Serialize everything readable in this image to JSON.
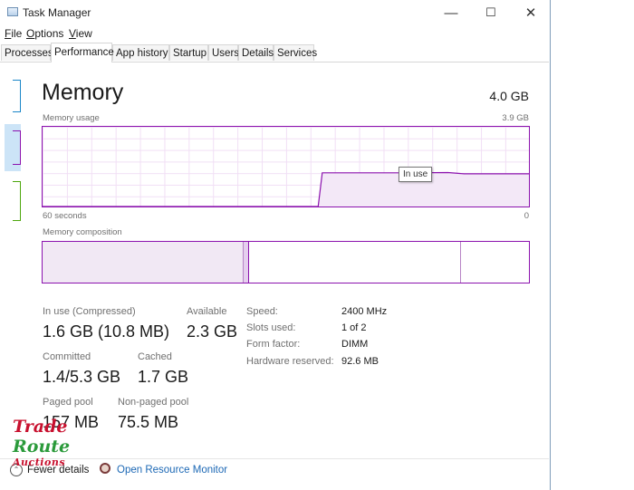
{
  "window": {
    "title": "Task Manager",
    "controls": {
      "minimize": "—",
      "maximize": "☐",
      "close": "✕"
    }
  },
  "menu": [
    "File",
    "Options",
    "View"
  ],
  "tabs": [
    {
      "label": "Processes",
      "active": false
    },
    {
      "label": "Performance",
      "active": true
    },
    {
      "label": "App history",
      "active": false
    },
    {
      "label": "Startup",
      "active": false
    },
    {
      "label": "Users",
      "active": false
    },
    {
      "label": "Details",
      "active": false
    },
    {
      "label": "Services",
      "active": false
    }
  ],
  "memory": {
    "heading": "Memory",
    "total": "4.0 GB",
    "usage_label": "Memory usage",
    "usage_max": "3.9 GB",
    "time_left": "60 seconds",
    "time_right": "0",
    "tooltip": "In use",
    "composition_label": "Memory composition"
  },
  "chart_data": {
    "type": "area",
    "title": "Memory usage",
    "xlabel": "",
    "ylabel": "",
    "xlim": [
      60,
      0
    ],
    "ylim": [
      0,
      3.9
    ],
    "x": [
      60,
      59,
      57,
      50,
      42,
      35,
      29,
      26,
      25.5,
      23,
      20,
      15,
      10,
      8,
      5,
      3,
      0
    ],
    "series": [
      {
        "values": [
          0,
          0,
          0,
          0,
          0,
          0,
          0,
          0,
          1.65,
          1.65,
          1.65,
          1.65,
          1.66,
          1.6,
          1.6,
          1.6,
          1.6
        ]
      }
    ],
    "grid": true,
    "accent": "#8b12ae",
    "fill": "#f3e8f7"
  },
  "composition": {
    "in_use_fraction": 0.412,
    "modified_fraction": 0.011,
    "standby_fraction": 0.434,
    "free_fraction": 0.143
  },
  "stats": {
    "in_use": {
      "label": "In use (Compressed)",
      "value": "1.6 GB (10.8 MB)"
    },
    "available": {
      "label": "Available",
      "value": "2.3 GB"
    },
    "committed": {
      "label": "Committed",
      "value": "1.4/5.3 GB"
    },
    "cached": {
      "label": "Cached",
      "value": "1.7 GB"
    },
    "paged_pool": {
      "label": "Paged pool",
      "value": "157 MB"
    },
    "non_paged_pool": {
      "label": "Non-paged pool",
      "value": "75.5 MB"
    }
  },
  "specs": [
    {
      "label": "Speed:",
      "value": "2400 MHz"
    },
    {
      "label": "Slots used:",
      "value": "1 of 2"
    },
    {
      "label": "Form factor:",
      "value": "DIMM"
    },
    {
      "label": "Hardware reserved:",
      "value": "92.6 MB"
    }
  ],
  "footer": {
    "fewer_details": "Fewer details",
    "open_monitor": "Open Resource Monitor"
  },
  "watermark": {
    "line1": "Trade",
    "line2": "Route",
    "line3": "Auctions"
  }
}
